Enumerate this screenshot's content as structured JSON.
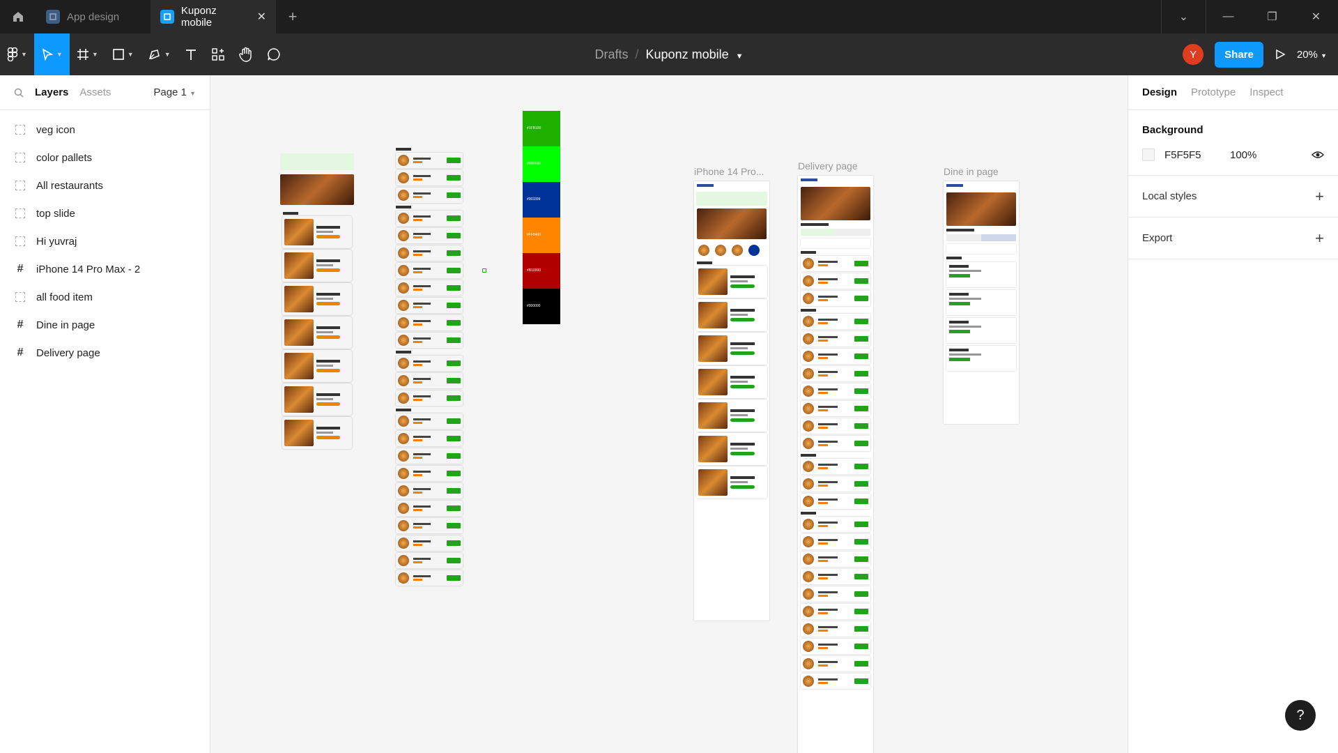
{
  "tabs": [
    {
      "label": "App design",
      "active": false
    },
    {
      "label": "Kuponz mobile",
      "active": true
    }
  ],
  "breadcrumb": {
    "parent": "Drafts",
    "separator": "/",
    "file": "Kuponz mobile"
  },
  "toolbar": {
    "share_label": "Share",
    "zoom": "20%",
    "avatar_letter": "Y"
  },
  "left_panel": {
    "tab_layers": "Layers",
    "tab_assets": "Assets",
    "page_select": "Page 1",
    "layers": [
      {
        "name": "veg icon",
        "type": "group"
      },
      {
        "name": "color pallets",
        "type": "group"
      },
      {
        "name": "All restaurants",
        "type": "group"
      },
      {
        "name": "top slide",
        "type": "group"
      },
      {
        "name": "Hi yuvraj",
        "type": "group"
      },
      {
        "name": "iPhone 14 Pro Max - 2",
        "type": "frame"
      },
      {
        "name": "all food item",
        "type": "group"
      },
      {
        "name": "Dine in page",
        "type": "frame"
      },
      {
        "name": "Delivery page",
        "type": "frame"
      }
    ]
  },
  "right_panel": {
    "tabs": [
      "Design",
      "Prototype",
      "Inspect"
    ],
    "background_title": "Background",
    "background_hex": "F5F5F5",
    "background_opacity": "100%",
    "local_styles": "Local styles",
    "export": "Export"
  },
  "canvas": {
    "frame_labels": {
      "iphone": "iPhone 14 Pro...",
      "delivery": "Delivery page",
      "dinein": "Dine in page"
    },
    "palette": [
      {
        "hex": "#1FB100",
        "label": "#1FB100"
      },
      {
        "hex": "#00FF00",
        "label": "#00FF00"
      },
      {
        "hex": "#003399",
        "label": "#003399"
      },
      {
        "hex": "#FF8400",
        "label": "#FF8400"
      },
      {
        "hex": "#B10000",
        "label": "#B10000"
      },
      {
        "hex": "#000000",
        "label": "#000000"
      }
    ]
  },
  "colors": {
    "accent": "#0d99ff",
    "brand_green": "#22a41a",
    "brand_orange": "#f77f00"
  }
}
